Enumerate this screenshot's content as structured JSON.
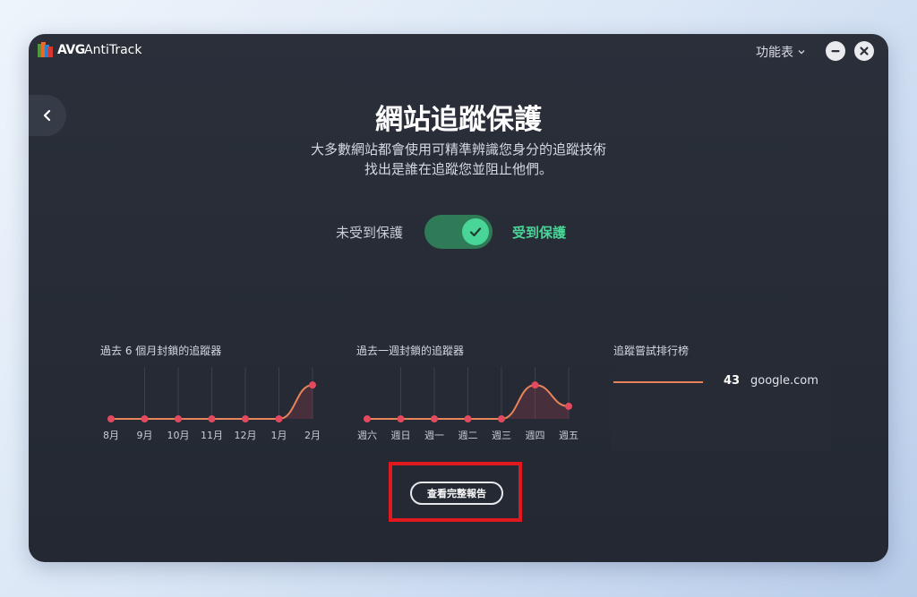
{
  "app": {
    "brand": "AVG",
    "product": "AntiTrack",
    "menu_label": "功能表"
  },
  "hero": {
    "title": "網站追蹤保護",
    "subtitle_line1": "大多數網站都會使用可精準辨識您身分的追蹤技術",
    "subtitle_line2": "找出是誰在追蹤您並阻止他們。"
  },
  "protection_toggle": {
    "label_off": "未受到保護",
    "label_on": "受到保護",
    "state": "on"
  },
  "charts": {
    "monthly_title": "過去 6 個月封鎖的追蹤器",
    "weekly_title": "過去一週封鎖的追蹤器",
    "ranking_title": "追蹤嘗試排行榜"
  },
  "chart_data": [
    {
      "type": "line",
      "title": "過去 6 個月封鎖的追蹤器",
      "categories": [
        "8月",
        "9月",
        "10月",
        "11月",
        "12月",
        "1月",
        "2月"
      ],
      "values": [
        0,
        0,
        0,
        0,
        0,
        0,
        43
      ],
      "ylim": [
        0,
        50
      ],
      "grid": "vertical"
    },
    {
      "type": "line",
      "title": "過去一週封鎖的追蹤器",
      "categories": [
        "週六",
        "週日",
        "週一",
        "週二",
        "週三",
        "週四",
        "週五"
      ],
      "values": [
        0,
        0,
        0,
        0,
        0,
        43,
        16
      ],
      "ylim": [
        0,
        50
      ],
      "grid": "vertical"
    }
  ],
  "ranking": [
    {
      "count": "43",
      "domain": "google.com"
    }
  ],
  "report_button": {
    "label": "查看完整報告"
  },
  "colors": {
    "accent_green": "#48d597",
    "toggle_track": "#2f7a57",
    "line_color": "#e7845a",
    "point_color": "#e24a5f",
    "highlight_red": "#e0191f"
  }
}
